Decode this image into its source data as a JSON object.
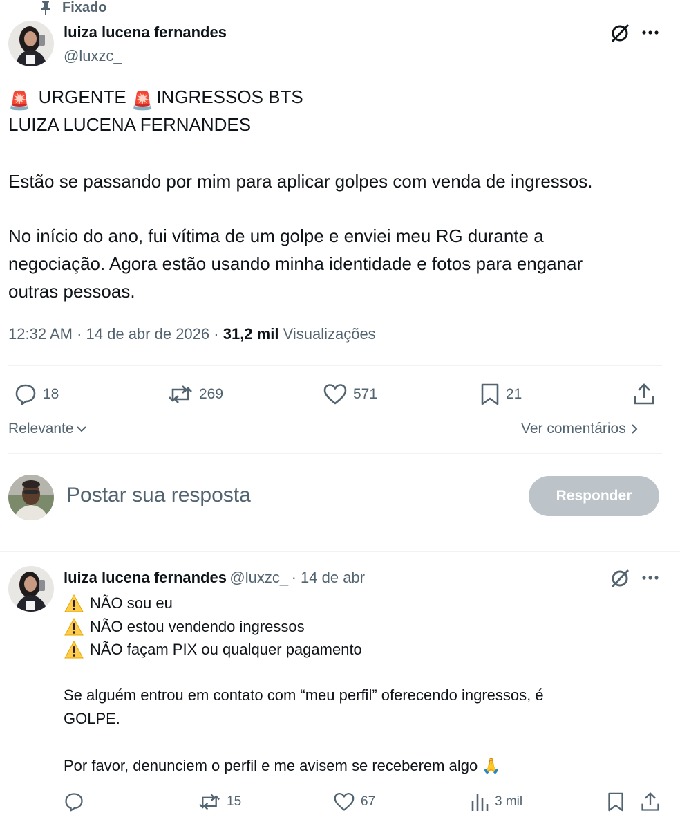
{
  "pinned": {
    "label": "Fixado"
  },
  "tweet": {
    "author_name": "luiza lucena fernandes",
    "author_handle": "@luxzc_",
    "lines": [
      {
        "emoji1": "🚨",
        "text1": " URGENTE ",
        "emoji2": "🚨",
        "text2": "INGRESSOS BTS"
      },
      "LUIZA LUCENA FERNANDES",
      "Estão se passando por mim para aplicar golpes com venda de ingressos.",
      "No início do ano, fui vítima de um golpe e enviei meu RG durante a",
      "negociação. Agora estão usando minha identidade e fotos para enganar",
      "outras pessoas."
    ],
    "time": "12:32 AM",
    "date": "14 de abr de 2026",
    "views_count": "31,2 mil",
    "views_label": "Visualizações",
    "actions": {
      "replies": "18",
      "reposts": "269",
      "likes": "571",
      "bookmarks": "21"
    }
  },
  "sort": {
    "label": "Relevante",
    "see_comments": "Ver comentários"
  },
  "compose": {
    "placeholder": "Postar sua resposta",
    "button": "Responder"
  },
  "reply": {
    "author_name": "luiza lucena fernandes",
    "author_handle": "@luxzc_",
    "date": "14 de abr",
    "warning_lines": [
      "NÃO sou eu",
      "NÃO estou vendendo ingressos",
      "NÃO façam PIX ou qualquer pagamento"
    ],
    "paragraph1_line1": "Se alguém entrou em contato com “meu perfil” oferecendo ingressos, é",
    "paragraph1_line2": "GOLPE.",
    "paragraph2": "Por favor, denunciem o perfil e me avisem se receberem algo",
    "paragraph2_emoji": "🙏",
    "actions": {
      "reposts": "15",
      "likes": "67",
      "views": "3 mil"
    }
  },
  "colors": {
    "text": "#0f1419",
    "muted": "#536471",
    "button_disabled": "#bcc3c9",
    "divider": "#eff3f4"
  }
}
